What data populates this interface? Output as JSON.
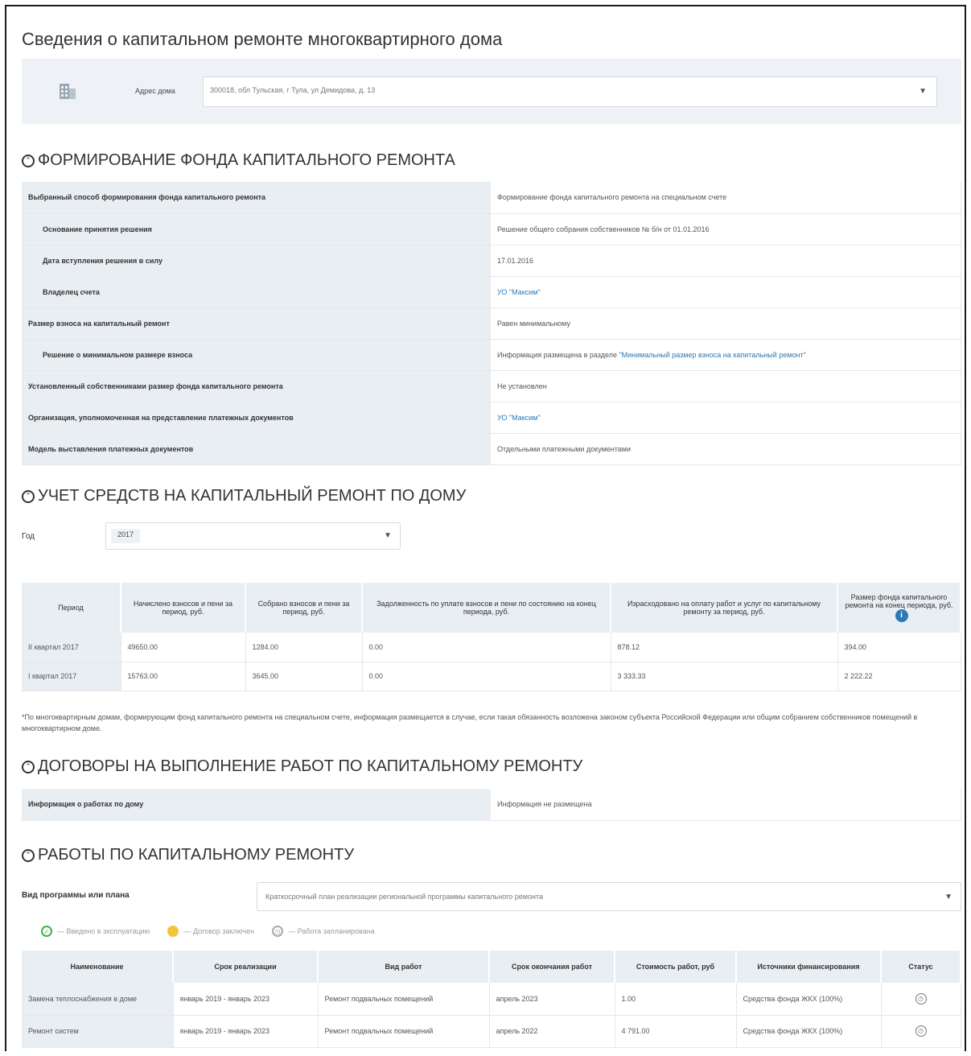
{
  "page_title": "Сведения о капитальном ремонте многоквартирного дома",
  "address": {
    "label": "Адрес дома",
    "value": "300018, обл Тульская, г Тула, ул Демидова, д. 13"
  },
  "section_fund": {
    "title": "ФОРМИРОВАНИЕ ФОНДА КАПИТАЛЬНОГО РЕМОНТА",
    "rows": [
      {
        "label": "Выбранный способ формирования фонда капитального ремонта",
        "value": "Формирование фонда капитального ремонта на специальном счете"
      },
      {
        "label": "Основание принятия решения",
        "value": "Решение общего собрания собственников № б/н от 01.01.2016"
      },
      {
        "label": "Дата вступления решения в силу",
        "value": "17.01.2016"
      },
      {
        "label": "Владелец счета",
        "value": "УО \"Максим\""
      },
      {
        "label": "Размер взноса на капитальный ремонт",
        "value": "Равен минимальному"
      },
      {
        "label": "Решение о минимальном размере взноса",
        "value_prefix": "Информация размещена в разделе ",
        "value_link": "\"Минимальный размер взноса на капитальный ремонт\""
      },
      {
        "label": "Установленный собственниками размер фонда капитального ремонта",
        "value": "Не установлен"
      },
      {
        "label": "Организация, уполномоченная на представление платежных документов",
        "value": "УО \"Максим\""
      },
      {
        "label": "Модель выставления платежных документов",
        "value": "Отдельными платежными документами"
      }
    ]
  },
  "section_funds_accounting": {
    "title": "УЧЕТ СРЕДСТВ НА КАПИТАЛЬНЫЙ РЕМОНТ ПО ДОМУ",
    "year_label": "Год",
    "year_value": "2017",
    "columns": [
      "Период",
      "Начислено взносов и пени за период, руб.",
      "Собрано взносов и пени за период, руб.",
      "Задолженность по уплате взносов и пени по состоянию на конец периода, руб.",
      "Израсходовано на оплату работ и услуг по капитальному ремонту за период, руб.",
      "Размер фонда капитального ремонта на конец периода, руб."
    ],
    "rows": [
      [
        "II квартал 2017",
        "49650.00",
        "1284.00",
        "0.00",
        "878.12",
        "394.00"
      ],
      [
        "I квартал 2017",
        "15763.00",
        "3645.00",
        "0.00",
        "3 333.33",
        "2 222.22"
      ]
    ],
    "note": "*По многоквартирным домам, формирующим фонд капитального ремонта на специальном счете, информация размещается в случае, если такая обязанность возложена законом субъекта Российской Федерации или общим собранием собственников помещений в многоквартирном доме."
  },
  "section_contracts": {
    "title": "ДОГОВОРЫ НА ВЫПОЛНЕНИЕ РАБОТ ПО КАПИТАЛЬНОМУ РЕМОНТУ",
    "label": "Информация о работах по дому",
    "value": "Информация не размещена"
  },
  "section_works": {
    "title": "РАБОТЫ ПО КАПИТАЛЬНОМУ РЕМОНТУ",
    "program_label": "Вид программы или плана",
    "program_value": "Краткосрочный план реализации региональной программы капитального ремонта",
    "legend": [
      "— Введено в эксплуатацию",
      "— Договор заключен",
      "— Работа запланирована"
    ],
    "columns": [
      "Наименование",
      "Срок реализации",
      "Вид работ",
      "Срок окончания работ",
      "Стоимость работ, руб",
      "Источники финансирования",
      "Статус"
    ],
    "rows": [
      [
        "Замена теплоснабжения в доме",
        "январь 2019 - январь 2023",
        "Ремонт подвальных помещений",
        "апрель 2023",
        "1.00",
        "Средства фонда ЖКХ (100%)"
      ],
      [
        "Ремонт систем",
        "январь 2019 - январь 2023",
        "Ремонт подвальных помещений",
        "апрель 2022",
        "4 791.00",
        "Средства фонда ЖКХ (100%)"
      ]
    ]
  },
  "colors": {
    "accent": "#2a7ab8",
    "label_bg": "#e9eef3",
    "green": "#3cb34a",
    "yellow": "#f3c33c"
  }
}
